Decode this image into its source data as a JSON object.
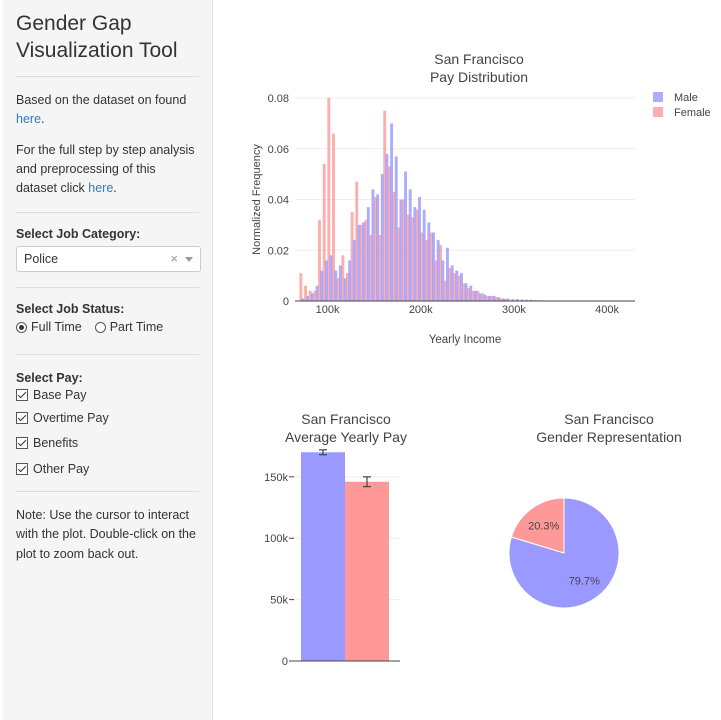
{
  "sidebar": {
    "title_line1": "Gender Gap",
    "title_line2": "Visualization Tool",
    "intro_text": "Based on the dataset on found",
    "intro_link": "here",
    "analysis_text": "For the full step by step analysis and preprocessing of this dataset click",
    "analysis_link": "here",
    "job_category": {
      "label": "Select Job Category:",
      "value": "Police",
      "clear": "×"
    },
    "job_status": {
      "label": "Select Job Status:",
      "options": [
        {
          "label": "Full Time",
          "selected": true
        },
        {
          "label": "Part Time",
          "selected": false
        }
      ]
    },
    "pay": {
      "label": "Select Pay:",
      "options": [
        {
          "label": "Base Pay",
          "checked": true
        },
        {
          "label": "Overtime Pay",
          "checked": true
        },
        {
          "label": "Benefits",
          "checked": true
        },
        {
          "label": "Other Pay",
          "checked": true
        }
      ]
    },
    "note": "Note: Use the cursor to interact with the plot. Double-click on the plot to zoom back out."
  },
  "colors": {
    "male": "#9999ff",
    "female": "#ff9999"
  },
  "chart_data": [
    {
      "type": "bar",
      "subtype": "histogram",
      "title_line1": "San Francisco",
      "title_line2": "Pay Distribution",
      "xlabel": "Yearly Income",
      "ylabel": "Normalized Frequency",
      "xlim": [
        65000,
        430000
      ],
      "ylim": [
        0,
        0.08
      ],
      "x_ticks": [
        100000,
        200000,
        300000,
        400000
      ],
      "x_tick_labels": [
        "100k",
        "200k",
        "300k",
        "400k"
      ],
      "y_ticks": [
        0,
        0.02,
        0.04,
        0.06,
        0.08
      ],
      "y_tick_labels": [
        "0",
        "0.02",
        "0.04",
        "0.06",
        "0.08"
      ],
      "legend": "top-right",
      "bin_width": 5000,
      "series": [
        {
          "name": "Male",
          "bin_starts": [
            70000,
            75000,
            80000,
            85000,
            90000,
            95000,
            100000,
            105000,
            110000,
            115000,
            120000,
            125000,
            130000,
            135000,
            140000,
            145000,
            150000,
            155000,
            160000,
            165000,
            170000,
            175000,
            180000,
            185000,
            190000,
            195000,
            200000,
            205000,
            210000,
            215000,
            220000,
            225000,
            230000,
            235000,
            240000,
            245000,
            250000,
            255000,
            260000,
            265000,
            270000,
            275000,
            280000,
            285000,
            290000,
            295000,
            300000,
            305000,
            310000,
            315000,
            320000,
            325000
          ],
          "values": [
            0.001,
            0.002,
            0.003,
            0.006,
            0.012,
            0.016,
            0.018,
            0.012,
            0.014,
            0.009,
            0.016,
            0.024,
            0.03,
            0.031,
            0.037,
            0.044,
            0.042,
            0.05,
            0.058,
            0.07,
            0.057,
            0.04,
            0.051,
            0.044,
            0.037,
            0.041,
            0.036,
            0.031,
            0.027,
            0.024,
            0.016,
            0.021,
            0.014,
            0.012,
            0.011,
            0.007,
            0.006,
            0.004,
            0.003,
            0.0025,
            0.002,
            0.002,
            0.0015,
            0.001,
            0.001,
            0.0008,
            0.0008,
            0.0006,
            0.0005,
            0.0005,
            0.0003,
            0.0003
          ]
        },
        {
          "name": "Female",
          "bin_starts": [
            70000,
            75000,
            80000,
            85000,
            90000,
            95000,
            100000,
            105000,
            110000,
            115000,
            120000,
            125000,
            130000,
            135000,
            140000,
            145000,
            150000,
            155000,
            160000,
            165000,
            170000,
            175000,
            180000,
            185000,
            190000,
            195000,
            200000,
            205000,
            210000,
            215000,
            220000,
            225000,
            230000,
            235000,
            240000,
            245000,
            250000,
            255000,
            260000,
            265000,
            270000,
            275000,
            280000,
            285000,
            290000
          ],
          "values": [
            0.011,
            0.006,
            0.004,
            0.004,
            0.032,
            0.054,
            0.08,
            0.066,
            0.009,
            0.018,
            0.011,
            0.035,
            0.047,
            0.03,
            0.032,
            0.026,
            0.041,
            0.026,
            0.075,
            0.053,
            0.043,
            0.029,
            0.04,
            0.034,
            0.033,
            0.036,
            0.027,
            0.024,
            0.027,
            0.016,
            0.022,
            0.008,
            0.013,
            0.011,
            0.01,
            0.007,
            0.005,
            0.004,
            0.004,
            0.003,
            0.002,
            0.002,
            0.0015,
            0.001,
            0.0008
          ]
        }
      ]
    },
    {
      "type": "bar",
      "title_line1": "San Francisco",
      "title_line2": "Average Yearly Pay",
      "categories": [
        "Male",
        "Female"
      ],
      "values": [
        170000,
        146000
      ],
      "error": [
        2000,
        4000
      ],
      "ylim": [
        0,
        180000
      ],
      "y_ticks": [
        0,
        50000,
        100000,
        150000
      ],
      "y_tick_labels": [
        "0",
        "50k",
        "100k",
        "150k"
      ]
    },
    {
      "type": "pie",
      "title_line1": "San Francisco",
      "title_line2": "Gender Representation",
      "slices": [
        {
          "name": "Male",
          "value": 79.7,
          "label": "79.7%"
        },
        {
          "name": "Female",
          "value": 20.3,
          "label": "20.3%"
        }
      ]
    }
  ]
}
